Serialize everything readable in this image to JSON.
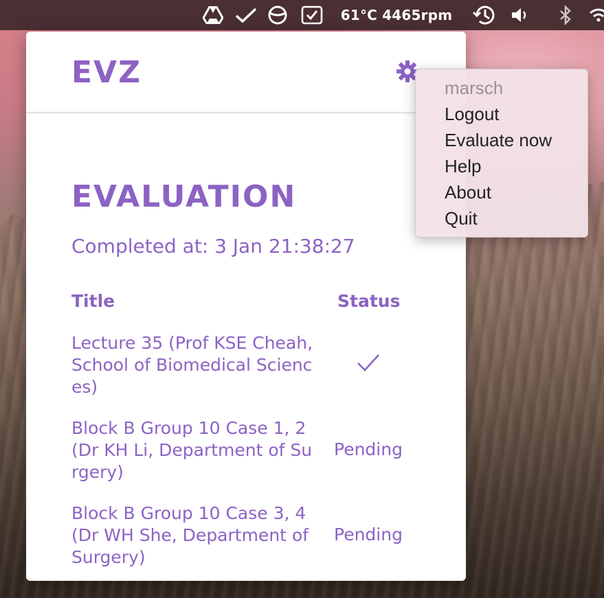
{
  "menubar": {
    "temperature_fan": "61°C 4465rpm",
    "icons": [
      "google-drive-icon",
      "checkmark-icon",
      "no-entry-icon",
      "task-check-icon",
      "time-machine-icon",
      "volume-icon",
      "bluetooth-icon",
      "wifi-icon"
    ]
  },
  "app": {
    "brand": "EVZ",
    "settings_icon": "gear-icon",
    "accent_color": "#8c63c4"
  },
  "evaluation": {
    "title": "EVALUATION",
    "completed_label": "Completed at: 3 Jan 21:38:27",
    "columns": {
      "title": "Title",
      "status": "Status"
    },
    "rows": [
      {
        "title": "Lecture 35 (Prof KSE Cheah, School of Biomedical Sciences)",
        "status": "✓"
      },
      {
        "title": "Block B Group 10 Case 1, 2 (Dr KH Li, Department of Surgery)",
        "status": "Pending"
      },
      {
        "title": "Block B Group 10 Case 3, 4 (Dr WH She, Department of Surgery)",
        "status": "Pending"
      }
    ]
  },
  "settings_menu": {
    "username": "marsch",
    "items": [
      "Logout",
      "Evaluate now",
      "Help",
      "About",
      "Quit"
    ]
  }
}
